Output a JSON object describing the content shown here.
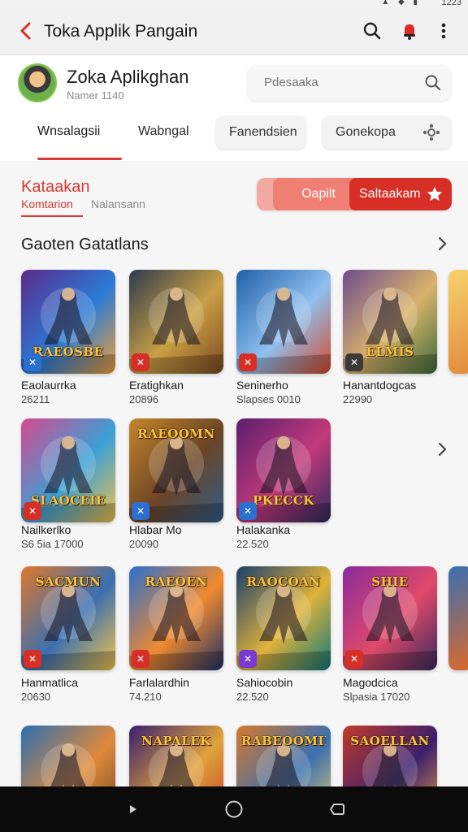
{
  "status": {
    "time": "1223",
    "icons": "▲ ◆ ▮"
  },
  "appbar": {
    "title": "Toka Applik Pangain",
    "icons": [
      "back-arrow-icon",
      "search-icon",
      "notification-icon",
      "more-vertical-icon"
    ]
  },
  "profile": {
    "name": "Zoka Aplikghan",
    "sub": "Namer 1140",
    "search_placeholder": "Pdesaaka"
  },
  "tabs": {
    "tab1": "Wnsalagsii",
    "tab2": "Wabngal",
    "chip1": "Fanendsien",
    "chip2": "Gonekopa"
  },
  "category": {
    "title": "Kataakan",
    "sub_active": "Komtarion",
    "sub_other": "Nalansann",
    "seg_left": "Oapilt",
    "seg_right": "Saltaakam"
  },
  "games_heading": "Gaoten Gatatlans",
  "colors": {
    "accent": "#d72f26",
    "accent_light": "#ef7f73"
  },
  "games": [
    {
      "name": "Eaolaurrka",
      "meta": "26211",
      "banner": "RAEOSBE"
    },
    {
      "name": "Eratighkan",
      "meta": "20896",
      "banner": ""
    },
    {
      "name": "Seninerho",
      "meta": "Slapses 0010",
      "banner": ""
    },
    {
      "name": "Hanantdogcas",
      "meta": "22990",
      "banner": "ELMIS"
    },
    {
      "name": "Nailkerlko",
      "meta": "S6 5ia 17000",
      "banner": "SLAOCEIE"
    },
    {
      "name": "Hlabar Mo",
      "meta": "20090",
      "banner": "RAEOOMN"
    },
    {
      "name": "Halakanka",
      "meta": "22.520",
      "banner": "PKECCK"
    },
    {
      "name": "Hanmatlica",
      "meta": "20630",
      "banner": "SACMUN"
    },
    {
      "name": "Farlalardhin",
      "meta": "74.210",
      "banner": "RAEOEN"
    },
    {
      "name": "Sahiocobin",
      "meta": "22.520",
      "banner": "RAOCOAN"
    },
    {
      "name": "Magodcica",
      "meta": "Slpasia 17020",
      "banner": "SHIE"
    },
    {
      "name": "",
      "meta": "",
      "banner": ""
    },
    {
      "name": "",
      "meta": "",
      "banner": "NAPALEK"
    },
    {
      "name": "",
      "meta": "",
      "banner": "RABEOOMIN"
    },
    {
      "name": "",
      "meta": "",
      "banner": "SAOELLAN"
    }
  ]
}
